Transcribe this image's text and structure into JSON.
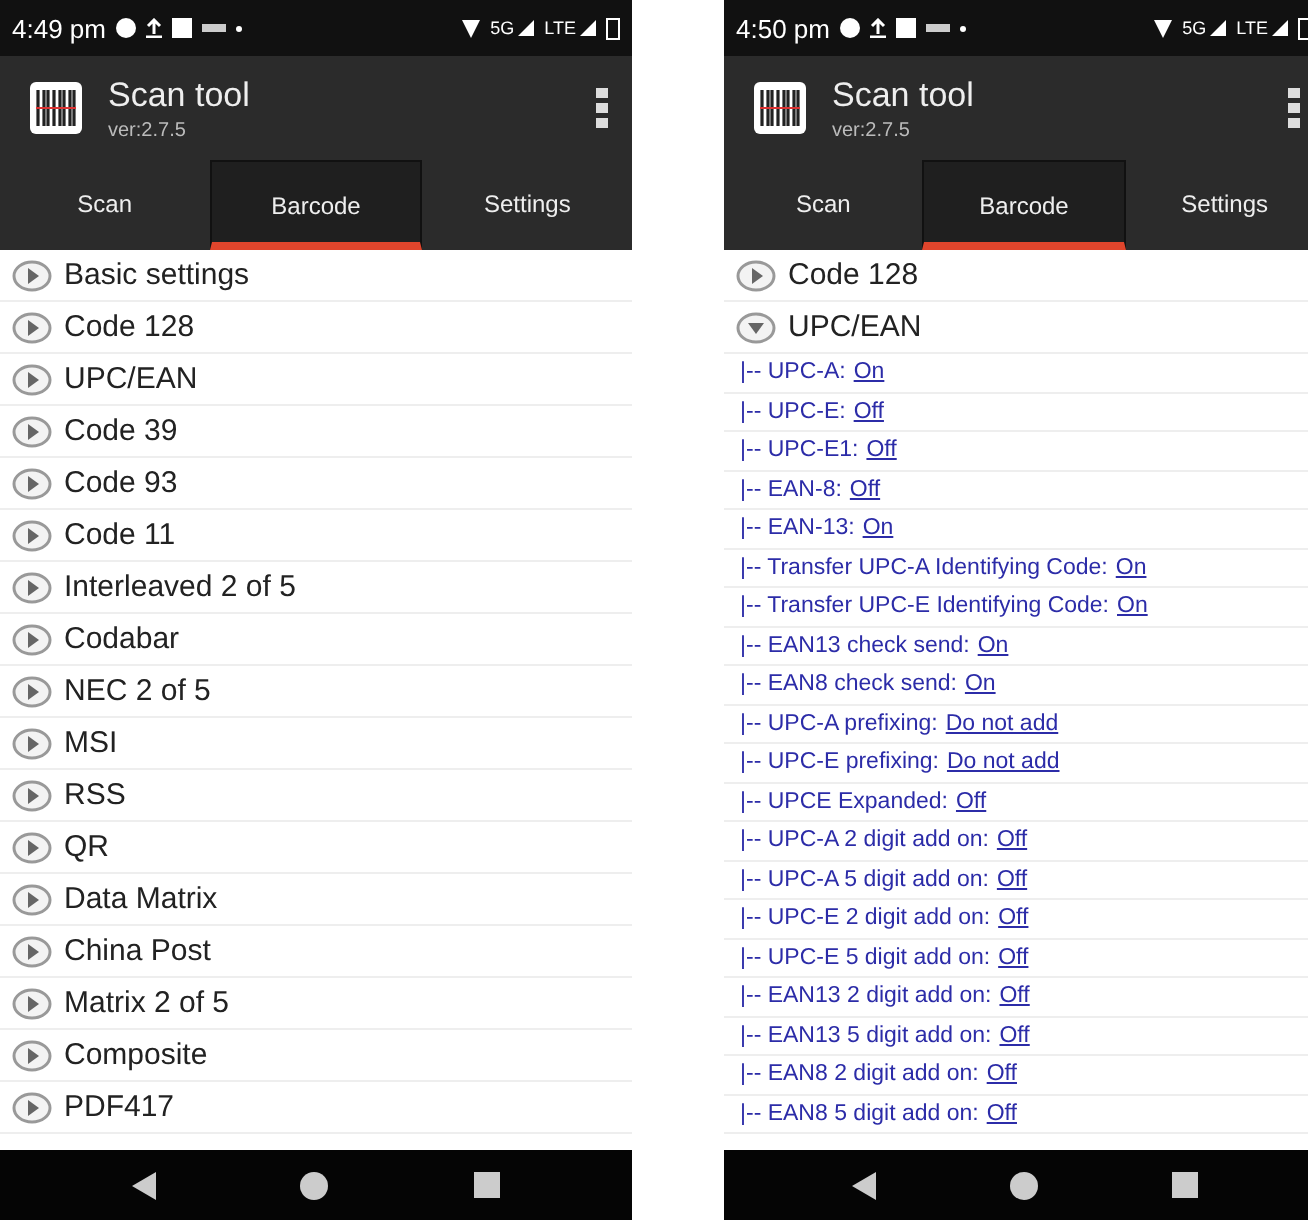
{
  "phones": [
    {
      "status_bar": {
        "time": "4:49 pm",
        "network": "5G",
        "network_2": "LTE"
      },
      "app_bar": {
        "title": "Scan tool",
        "version": "ver:2.7.5"
      },
      "tabs": [
        {
          "label": "Scan",
          "selected": false
        },
        {
          "label": "Barcode",
          "selected": true
        },
        {
          "label": "Settings",
          "selected": false
        }
      ],
      "list": [
        {
          "label": "Basic settings",
          "expanded": false
        },
        {
          "label": "Code 128",
          "expanded": false
        },
        {
          "label": "UPC/EAN",
          "expanded": false
        },
        {
          "label": "Code 39",
          "expanded": false
        },
        {
          "label": "Code 93",
          "expanded": false
        },
        {
          "label": "Code 11",
          "expanded": false
        },
        {
          "label": "Interleaved 2 of 5",
          "expanded": false
        },
        {
          "label": "Codabar",
          "expanded": false
        },
        {
          "label": "NEC 2 of 5",
          "expanded": false
        },
        {
          "label": "MSI",
          "expanded": false
        },
        {
          "label": "RSS",
          "expanded": false
        },
        {
          "label": "QR",
          "expanded": false
        },
        {
          "label": "Data Matrix",
          "expanded": false
        },
        {
          "label": "China Post",
          "expanded": false
        },
        {
          "label": "Matrix 2 of 5",
          "expanded": false
        },
        {
          "label": "Composite",
          "expanded": false
        },
        {
          "label": "PDF417",
          "expanded": false
        }
      ]
    },
    {
      "status_bar": {
        "time": "4:50 pm",
        "network": "5G",
        "network_2": "LTE"
      },
      "app_bar": {
        "title": "Scan tool",
        "version": "ver:2.7.5"
      },
      "tabs": [
        {
          "label": "Scan",
          "selected": false
        },
        {
          "label": "Barcode",
          "selected": true
        },
        {
          "label": "Settings",
          "selected": false
        }
      ],
      "list": [
        {
          "label": "Code 128",
          "expanded": false
        },
        {
          "label": "UPC/EAN",
          "expanded": true,
          "children": [
            {
              "label": "|-- UPC-A:",
              "value": "On"
            },
            {
              "label": "|-- UPC-E:",
              "value": "Off"
            },
            {
              "label": "|-- UPC-E1:",
              "value": "Off"
            },
            {
              "label": "|-- EAN-8:",
              "value": "Off"
            },
            {
              "label": "|-- EAN-13:",
              "value": "On"
            },
            {
              "label": "|-- Transfer UPC-A Identifying Code:",
              "value": "On"
            },
            {
              "label": "|-- Transfer UPC-E Identifying Code:",
              "value": "On"
            },
            {
              "label": "|-- EAN13 check send:",
              "value": "On"
            },
            {
              "label": "|-- EAN8 check send:",
              "value": "On"
            },
            {
              "label": "|-- UPC-A prefixing:",
              "value": "Do not add"
            },
            {
              "label": "|-- UPC-E prefixing:",
              "value": "Do not add"
            },
            {
              "label": "|-- UPCE Expanded:",
              "value": "Off"
            },
            {
              "label": "|-- UPC-A 2 digit add on:",
              "value": "Off"
            },
            {
              "label": "|-- UPC-A 5 digit add on:",
              "value": "Off"
            },
            {
              "label": "|-- UPC-E 2 digit add on:",
              "value": "Off"
            },
            {
              "label": "|-- UPC-E 5 digit add on:",
              "value": "Off"
            },
            {
              "label": "|-- EAN13 2 digit add on:",
              "value": "Off"
            },
            {
              "label": "|-- EAN13 5 digit add on:",
              "value": "Off"
            },
            {
              "label": "|-- EAN8 2 digit add on:",
              "value": "Off"
            },
            {
              "label": "|-- EAN8 5 digit add on:",
              "value": "Off"
            }
          ]
        }
      ]
    }
  ]
}
